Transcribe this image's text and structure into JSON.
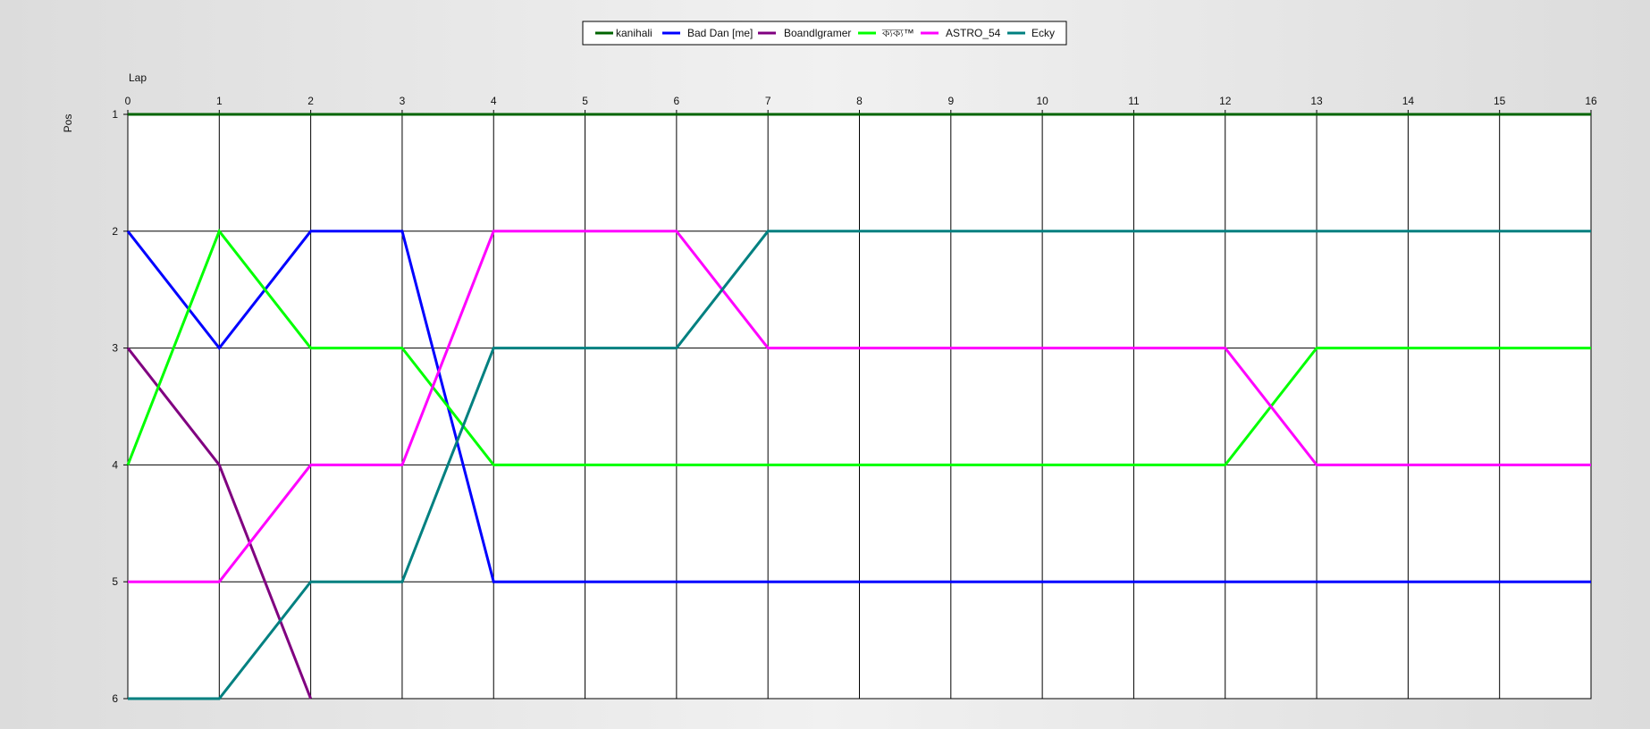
{
  "chart_data": {
    "type": "line",
    "title": "",
    "xlabel": "Lap",
    "ylabel": "Pos",
    "x": [
      0,
      1,
      2,
      3,
      4,
      5,
      6,
      7,
      8,
      9,
      10,
      11,
      12,
      13,
      14,
      15,
      16
    ],
    "xlim": [
      0,
      16
    ],
    "ylim": [
      1,
      6
    ],
    "y_inverted": true,
    "x_ticks": [
      "0",
      "1",
      "2",
      "3",
      "4",
      "5",
      "6",
      "7",
      "8",
      "9",
      "10",
      "11",
      "12",
      "13",
      "14",
      "15",
      "16"
    ],
    "y_ticks": [
      "1",
      "2",
      "3",
      "4",
      "5",
      "6"
    ],
    "grid": true,
    "legend_position": "top-center",
    "series": [
      {
        "name": "kanihali",
        "color": "#006400",
        "values": [
          1,
          1,
          1,
          1,
          1,
          1,
          1,
          1,
          1,
          1,
          1,
          1,
          1,
          1,
          1,
          1,
          1
        ]
      },
      {
        "name": "Bad Dan [me]",
        "color": "#0000ff",
        "values": [
          2,
          3,
          2,
          2,
          5,
          5,
          5,
          5,
          5,
          5,
          5,
          5,
          5,
          5,
          5,
          5,
          5
        ]
      },
      {
        "name": "Boandlgramer",
        "color": "#800080",
        "values": [
          3,
          4,
          6
        ]
      },
      {
        "name": "ক্যক্য™",
        "color": "#00ff00",
        "values": [
          4,
          2,
          3,
          3,
          4,
          4,
          4,
          4,
          4,
          4,
          4,
          4,
          4,
          3,
          3,
          3,
          3
        ]
      },
      {
        "name": "ASTRO_54",
        "color": "#ff00ff",
        "values": [
          5,
          5,
          4,
          4,
          2,
          2,
          2,
          3,
          3,
          3,
          3,
          3,
          3,
          4,
          4,
          4,
          4
        ]
      },
      {
        "name": "Ecky",
        "color": "#008080",
        "values": [
          6,
          6,
          5,
          5,
          3,
          3,
          3,
          2,
          2,
          2,
          2,
          2,
          2,
          2,
          2,
          2,
          2
        ]
      }
    ]
  }
}
